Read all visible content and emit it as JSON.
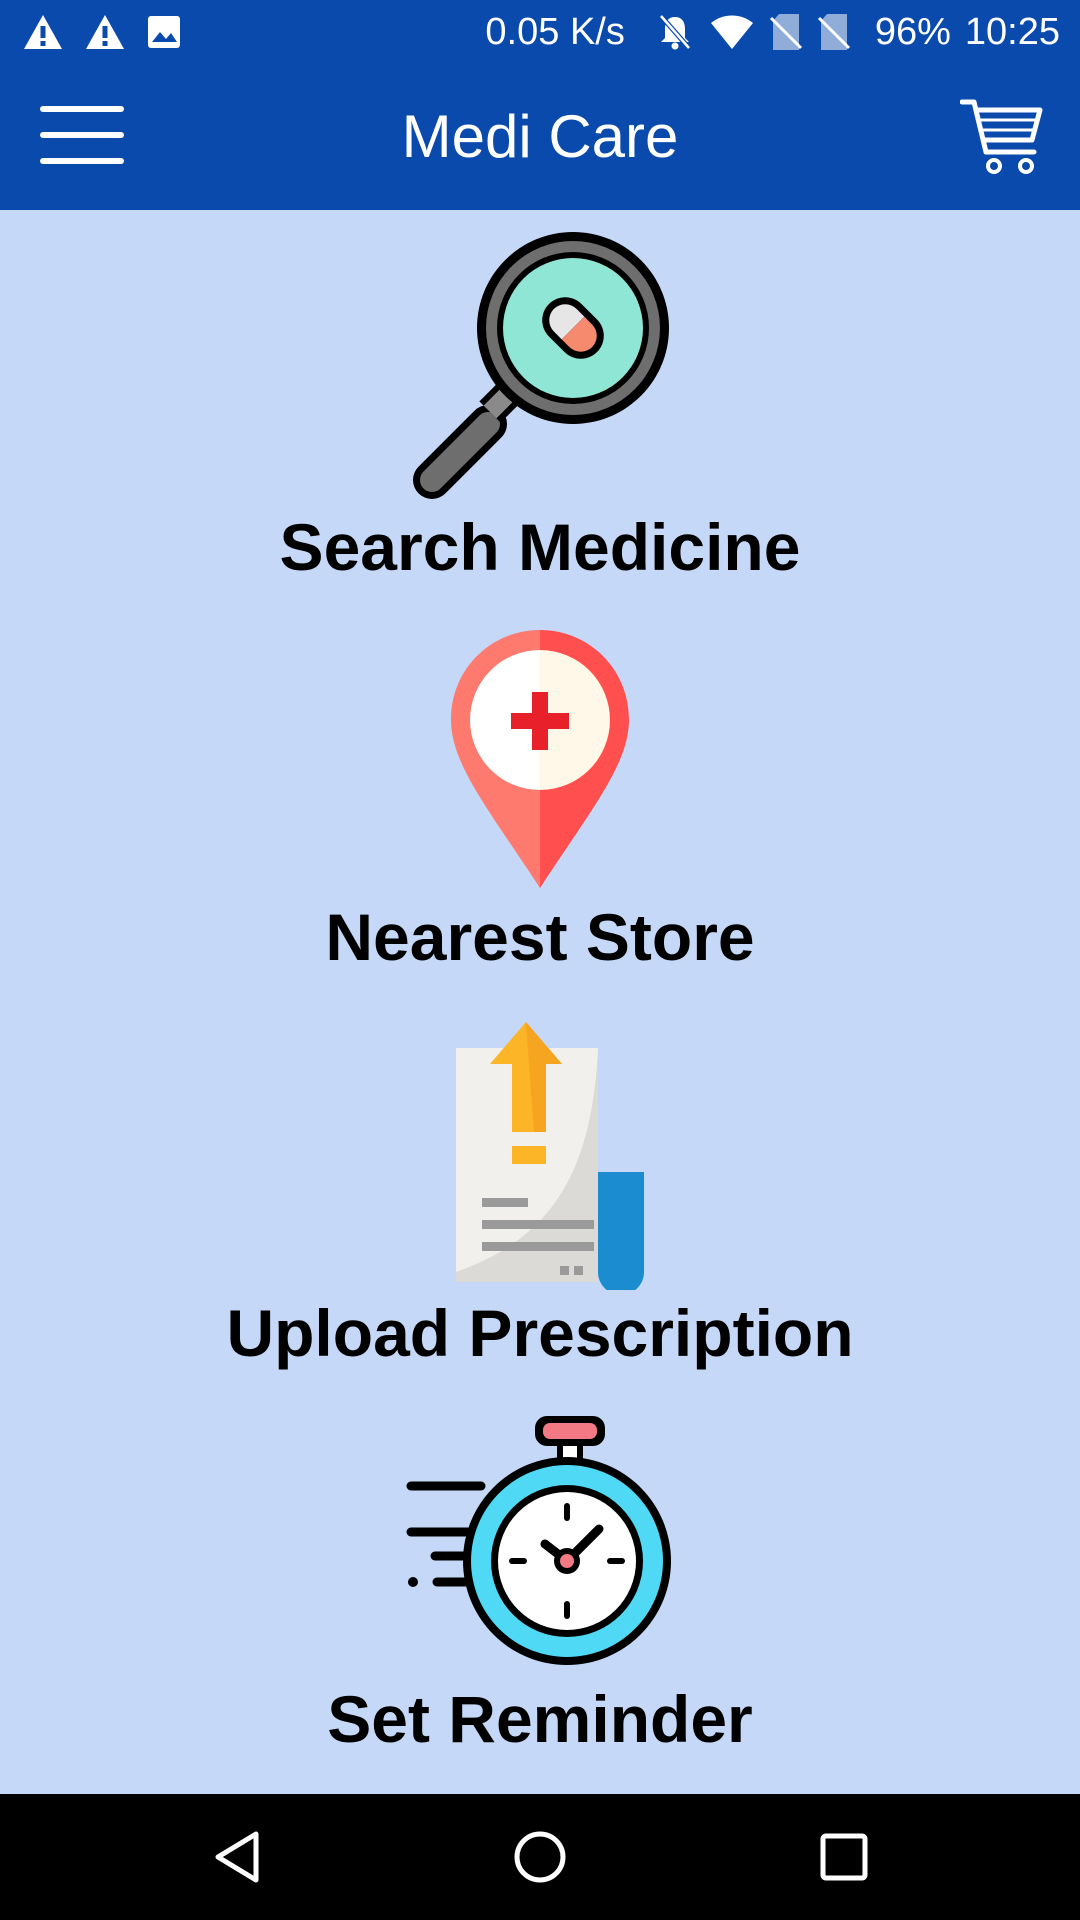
{
  "status_bar": {
    "network_speed": "0.05 K/s",
    "battery": "96%",
    "time": "10:25",
    "left_icons": [
      "warning-icon",
      "warning-icon",
      "image-icon"
    ],
    "right_icons": [
      "bell-muted-icon",
      "wifi-icon",
      "no-sim-icon",
      "no-sim-icon"
    ]
  },
  "app_bar": {
    "title": "Medi Care",
    "menu_icon": "hamburger-menu-icon",
    "cart_icon": "shopping-cart-icon"
  },
  "menu_items": [
    {
      "label": "Search Medicine",
      "icon": "magnifier-pill-icon"
    },
    {
      "label": "Nearest Store",
      "icon": "location-pin-cross-icon"
    },
    {
      "label": "Upload Prescription",
      "icon": "prescription-upload-icon"
    },
    {
      "label": "Set Reminder",
      "icon": "stopwatch-icon"
    }
  ],
  "nav_bar": {
    "icons": [
      "back-icon",
      "home-icon",
      "recents-icon"
    ]
  },
  "colors": {
    "primary": "#0a4aad",
    "background": "#c5d8f7",
    "nav_bar": "#000000"
  }
}
